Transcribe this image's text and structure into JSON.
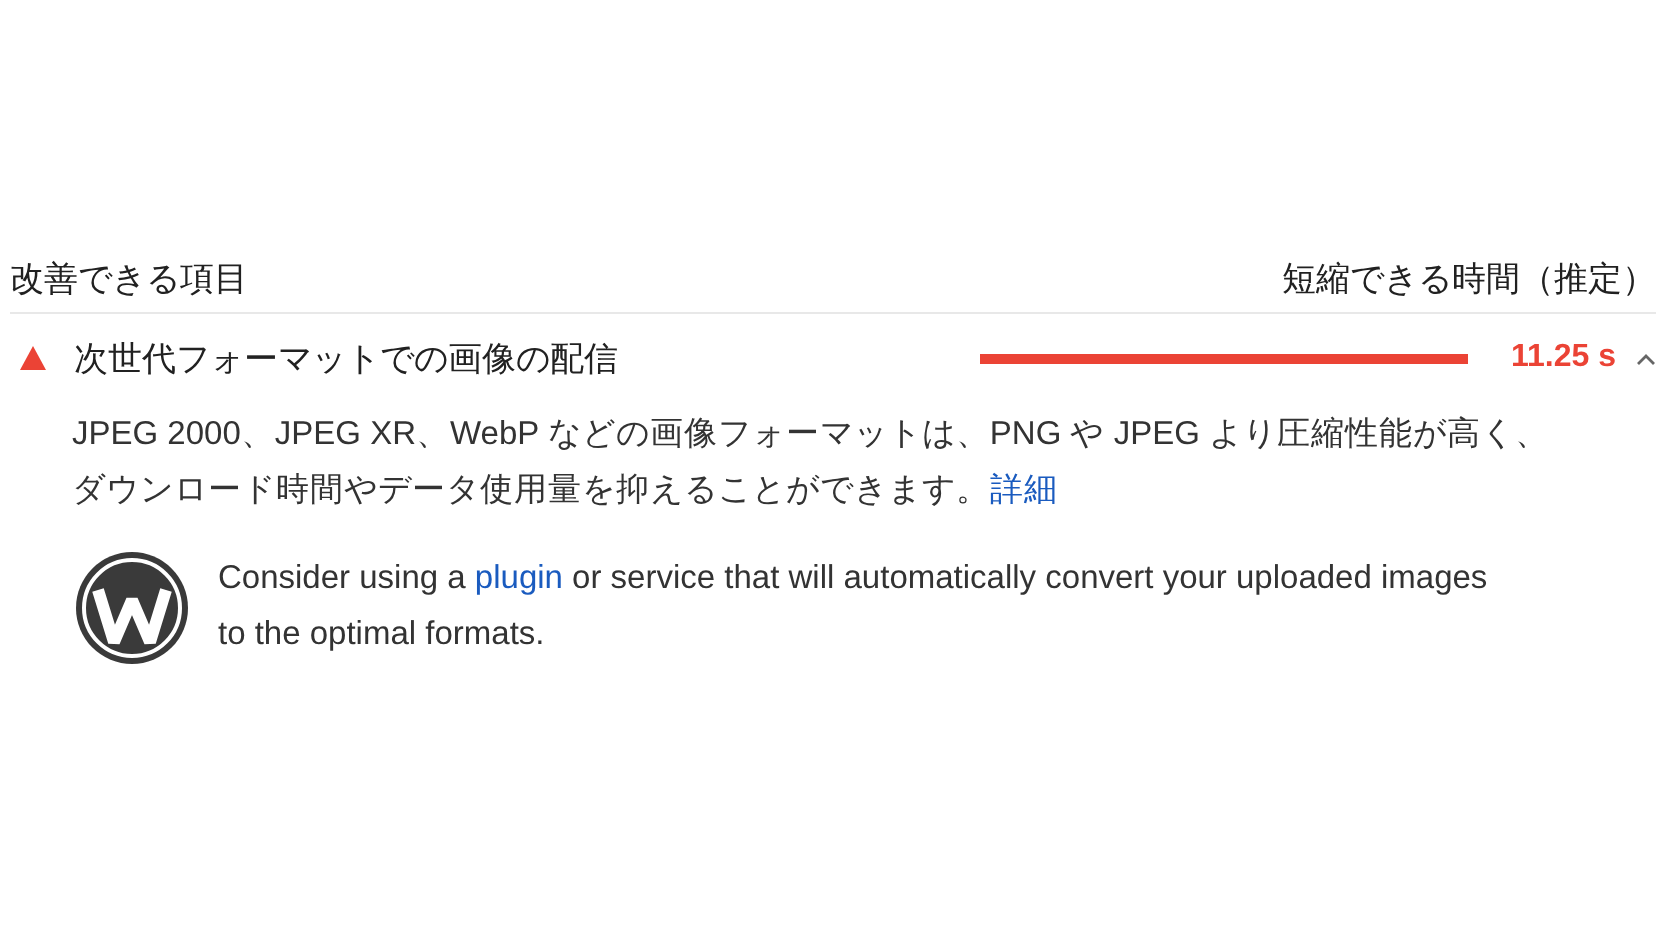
{
  "header": {
    "label": "改善できる項目",
    "savings_label": "短縮できる時間（推定）"
  },
  "audits": [
    {
      "color": "#eb4335",
      "title": "次世代フォーマットでの画像の配信",
      "savings": "11.25 s",
      "expanded": true,
      "description": "JPEG 2000、JPEG XR、WebP などの画像フォーマットは、PNG や JPEG より圧縮性能が高く、ダウンロード時間やデータ使用量を抑えることができます。",
      "description_link": "詳細",
      "hint": {
        "before": "Consider using a ",
        "link": "plugin",
        "after": " or service that will automatically convert your uploaded images to the optimal formats."
      }
    }
  ]
}
